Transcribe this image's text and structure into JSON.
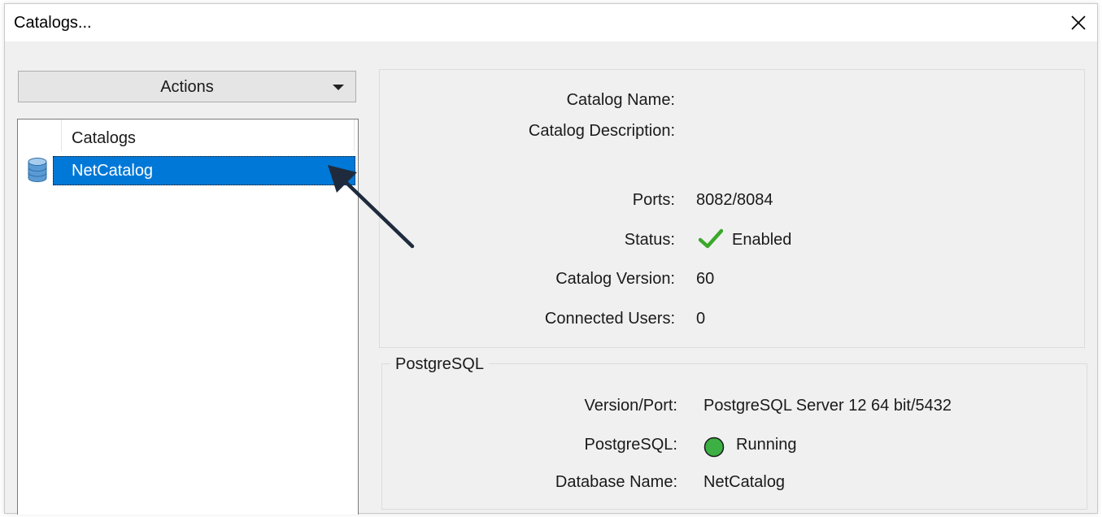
{
  "window": {
    "title": "Catalogs..."
  },
  "toolbar": {
    "actions_label": "Actions"
  },
  "tree": {
    "header": "Catalogs",
    "items": [
      {
        "label": "NetCatalog",
        "selected": true
      }
    ]
  },
  "catalog_info": {
    "catalog_name_label": "Catalog Name:",
    "catalog_description_label": "Catalog Description:",
    "ports_label": "Ports:",
    "ports_value": "8082/8084",
    "status_label": "Status:",
    "status_value": "Enabled",
    "catalog_version_label": "Catalog Version:",
    "catalog_version_value": "60",
    "connected_users_label": "Connected Users:",
    "connected_users_value": "0"
  },
  "postgresql": {
    "group_title": "PostgreSQL",
    "version_port_label": "Version/Port:",
    "version_port_value": "PostgreSQL Server 12 64 bit/5432",
    "postgresql_label": "PostgreSQL:",
    "postgresql_value": "Running",
    "database_name_label": "Database Name:",
    "database_name_value": "NetCatalog"
  },
  "colors": {
    "selection": "#0078d7",
    "status_check": "#3aa829",
    "running_dot": "#3cb043",
    "annotation_arrow": "#1f2b3d"
  },
  "icons": [
    "close-icon",
    "chevron-down-icon",
    "database-icon",
    "checkmark-icon",
    "green-circle-icon"
  ]
}
